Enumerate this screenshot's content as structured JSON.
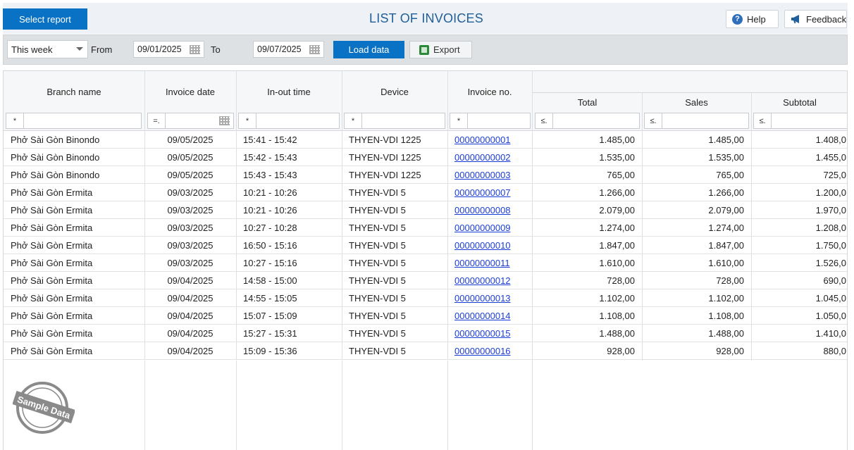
{
  "header": {
    "select_report_label": "Select report",
    "title": "LIST OF INVOICES",
    "help_label": "Help",
    "feedback_label": "Feedback"
  },
  "toolbar": {
    "period": "This week",
    "from_label": "From",
    "from_date": "09/01/2025",
    "to_label": "To",
    "to_date": "09/07/2025",
    "load_label": "Load data",
    "export_label": "Export"
  },
  "table": {
    "columns": {
      "branch": "Branch name",
      "date": "Invoice date",
      "time": "In-out time",
      "device": "Device",
      "invoice_no": "Invoice no.",
      "total": "Total",
      "sales": "Sales",
      "subtotal": "Subtotal"
    },
    "filter_ops": {
      "branch": "*",
      "date": "=.",
      "time": "*",
      "device": "*",
      "invoice_no": "*",
      "total": "≤.",
      "sales": "≤.",
      "subtotal": "≤."
    },
    "rows": [
      {
        "branch": "Phở Sài Gòn Binondo",
        "date": "09/05/2025",
        "time": "15:41 - 15:42",
        "device": "THYEN-VDI 1225",
        "invoice_no": "00000000001",
        "total": "1.485,00",
        "sales": "1.485,00",
        "subtotal": "1.408,0"
      },
      {
        "branch": "Phở Sài Gòn Binondo",
        "date": "09/05/2025",
        "time": "15:42 - 15:43",
        "device": "THYEN-VDI 1225",
        "invoice_no": "00000000002",
        "total": "1.535,00",
        "sales": "1.535,00",
        "subtotal": "1.455,0"
      },
      {
        "branch": "Phở Sài Gòn Binondo",
        "date": "09/05/2025",
        "time": "15:43 - 15:43",
        "device": "THYEN-VDI 1225",
        "invoice_no": "00000000003",
        "total": "765,00",
        "sales": "765,00",
        "subtotal": "725,0"
      },
      {
        "branch": "Phở Sài Gòn Ermita",
        "date": "09/03/2025",
        "time": "10:21 - 10:26",
        "device": "THYEN-VDI 5",
        "invoice_no": "00000000007",
        "total": "1.266,00",
        "sales": "1.266,00",
        "subtotal": "1.200,0"
      },
      {
        "branch": "Phở Sài Gòn Ermita",
        "date": "09/03/2025",
        "time": "10:21 - 10:26",
        "device": "THYEN-VDI 5",
        "invoice_no": "00000000008",
        "total": "2.079,00",
        "sales": "2.079,00",
        "subtotal": "1.970,0"
      },
      {
        "branch": "Phở Sài Gòn Ermita",
        "date": "09/03/2025",
        "time": "10:27 - 10:28",
        "device": "THYEN-VDI 5",
        "invoice_no": "00000000009",
        "total": "1.274,00",
        "sales": "1.274,00",
        "subtotal": "1.208,0"
      },
      {
        "branch": "Phở Sài Gòn Ermita",
        "date": "09/03/2025",
        "time": "16:50 - 15:16",
        "device": "THYEN-VDI 5",
        "invoice_no": "00000000010",
        "total": "1.847,00",
        "sales": "1.847,00",
        "subtotal": "1.750,0"
      },
      {
        "branch": "Phở Sài Gòn Ermita",
        "date": "09/03/2025",
        "time": "10:27 - 15:16",
        "device": "THYEN-VDI 5",
        "invoice_no": "00000000011",
        "total": "1.610,00",
        "sales": "1.610,00",
        "subtotal": "1.526,0"
      },
      {
        "branch": "Phở Sài Gòn Ermita",
        "date": "09/04/2025",
        "time": "14:58 - 15:00",
        "device": "THYEN-VDI 5",
        "invoice_no": "00000000012",
        "total": "728,00",
        "sales": "728,00",
        "subtotal": "690,0"
      },
      {
        "branch": "Phở Sài Gòn Ermita",
        "date": "09/04/2025",
        "time": "14:55 - 15:05",
        "device": "THYEN-VDI 5",
        "invoice_no": "00000000013",
        "total": "1.102,00",
        "sales": "1.102,00",
        "subtotal": "1.045,0"
      },
      {
        "branch": "Phở Sài Gòn Ermita",
        "date": "09/04/2025",
        "time": "15:07 - 15:09",
        "device": "THYEN-VDI 5",
        "invoice_no": "00000000014",
        "total": "1.108,00",
        "sales": "1.108,00",
        "subtotal": "1.050,0"
      },
      {
        "branch": "Phở Sài Gòn Ermita",
        "date": "09/04/2025",
        "time": "15:27 - 15:31",
        "device": "THYEN-VDI 5",
        "invoice_no": "00000000015",
        "total": "1.488,00",
        "sales": "1.488,00",
        "subtotal": "1.410,0"
      },
      {
        "branch": "Phở Sài Gòn Ermita",
        "date": "09/04/2025",
        "time": "15:09 - 15:36",
        "device": "THYEN-VDI 5",
        "invoice_no": "00000000016",
        "total": "928,00",
        "sales": "928,00",
        "subtotal": "880,0"
      }
    ]
  },
  "stamp": {
    "text": "Sample Data"
  }
}
